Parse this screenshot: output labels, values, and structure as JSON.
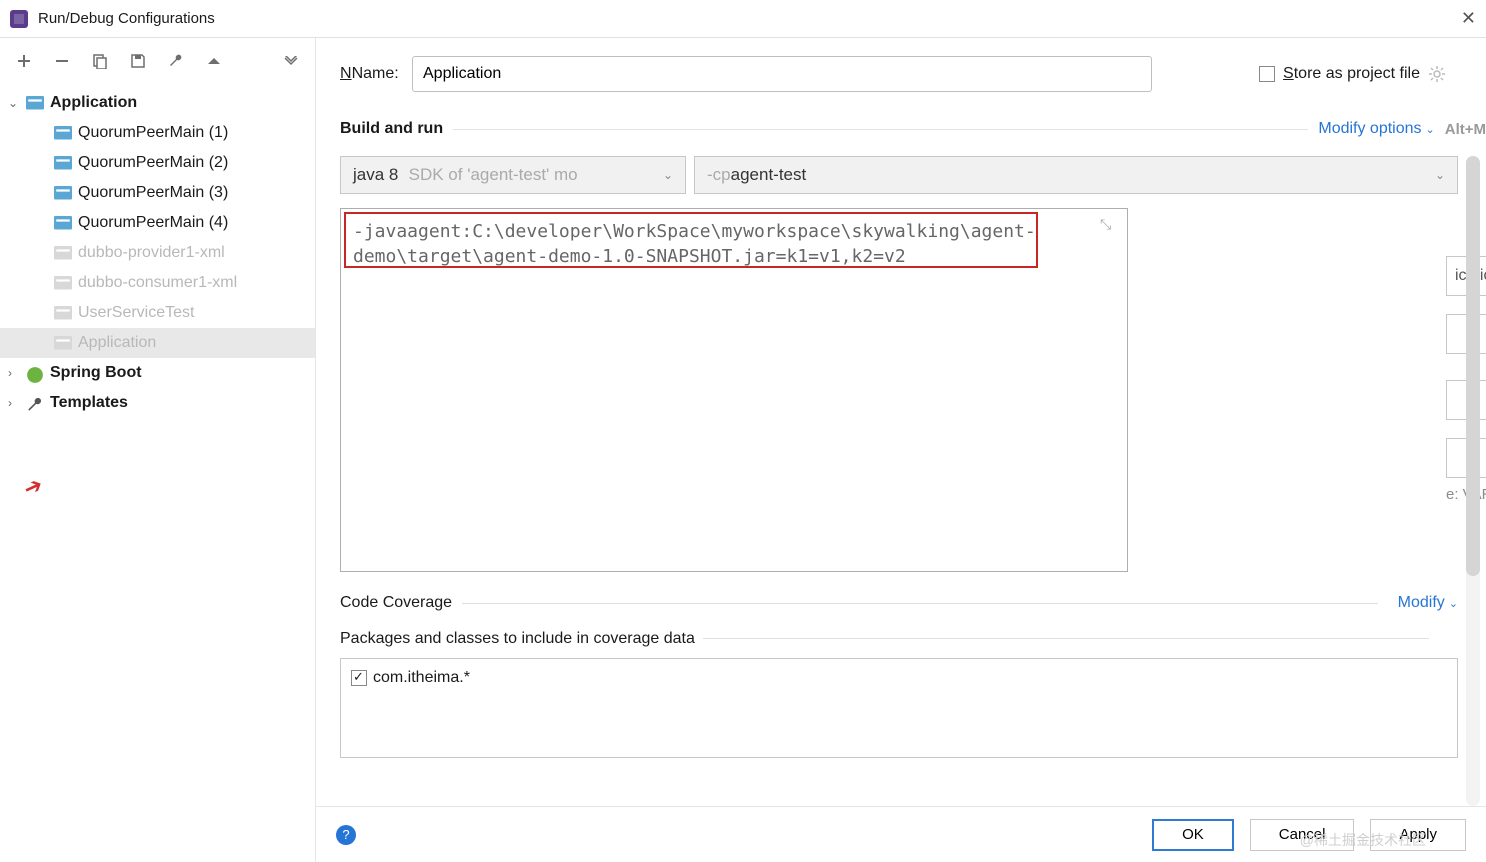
{
  "window": {
    "title": "Run/Debug Configurations"
  },
  "toolbar_icons": [
    "add",
    "remove",
    "copy",
    "save",
    "wrench",
    "up",
    "more"
  ],
  "tree": {
    "root": {
      "label": "Application"
    },
    "items": [
      {
        "label": "QuorumPeerMain  (1)",
        "dim": false
      },
      {
        "label": "QuorumPeerMain  (2)",
        "dim": false
      },
      {
        "label": "QuorumPeerMain  (3)",
        "dim": false
      },
      {
        "label": "QuorumPeerMain  (4)",
        "dim": false
      },
      {
        "label": "dubbo-provider1-xml",
        "dim": true
      },
      {
        "label": "dubbo-consumer1-xml",
        "dim": true
      },
      {
        "label": "UserServiceTest",
        "dim": true
      },
      {
        "label": "Application",
        "dim": true,
        "selected": true
      }
    ],
    "spring": "Spring Boot",
    "templates": "Templates"
  },
  "form": {
    "name_label": "Name:",
    "name_value": "Application",
    "store_label": "Store as project file",
    "build_run": "Build and run",
    "modify_options": "Modify options",
    "modify_hint": "Alt+M",
    "sdk_text_prefix": "java 8 ",
    "sdk_text_hint": "SDK of 'agent-test' mo",
    "cp_prefix": "-cp ",
    "cp_value": "agent-test",
    "vm_options": "-javaagent:C:\\developer\\WorkSpace\\myworkspace\\skywalking\\agent-demo\\target\\agent-demo-1.0-SNAPSHOT.jar=k1=v1,k2=v2",
    "field_frag_1": "ication",
    "env_hint": "e: VAR=value",
    "code_coverage": "Code Coverage",
    "modify": "Modify",
    "packages_label": "Packages and classes to include in coverage data",
    "package_item": "com.itheima.*"
  },
  "buttons": {
    "ok": "OK",
    "cancel": "Cancel",
    "apply": "Apply"
  },
  "watermark": "@稀土掘金技术社区"
}
